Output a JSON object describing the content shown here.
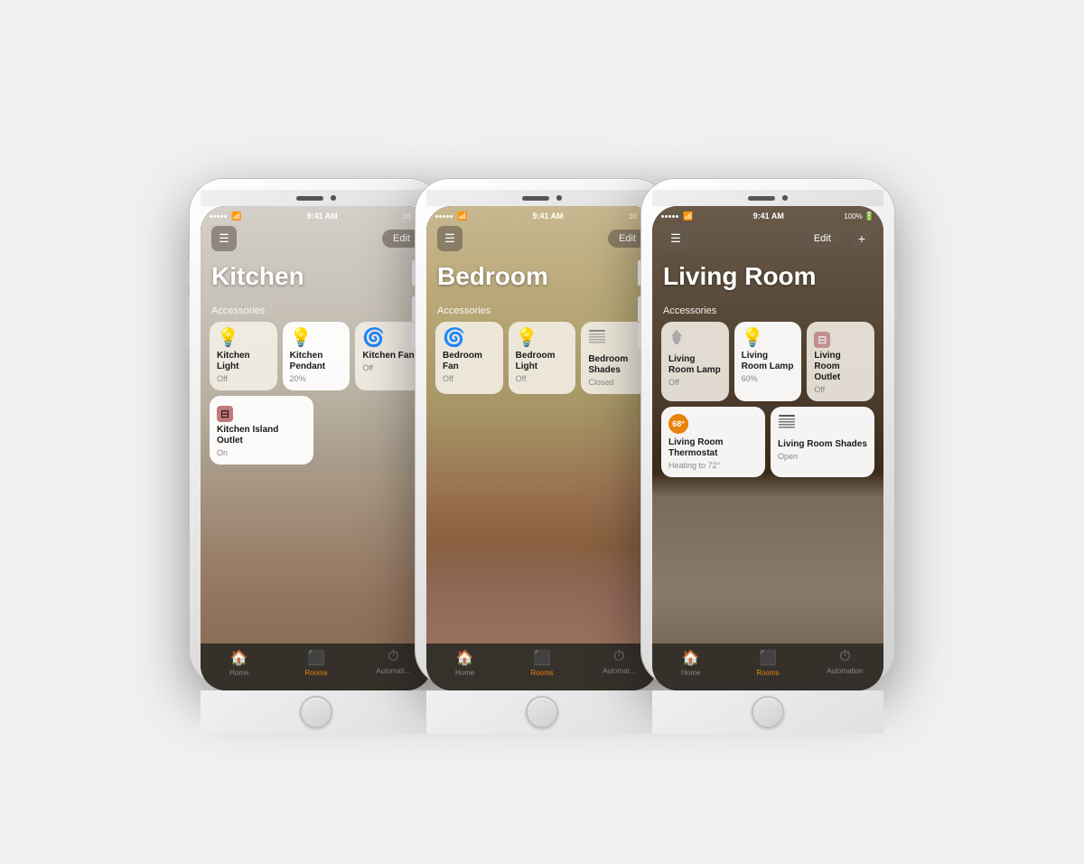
{
  "phones": [
    {
      "id": "kitchen",
      "room_name": "Kitchen",
      "bg_class": "room-bg-kitchen",
      "status_bar": {
        "left": "••••• WiFi",
        "center": "9:41 AM",
        "right": "10"
      },
      "has_plus": false,
      "accessories_label": "Accessories",
      "tiles_row1": [
        {
          "icon": "💡",
          "icon_class": "icon-gray",
          "name": "Kitchen Light",
          "status": "Off",
          "active": false
        },
        {
          "icon": "💡",
          "icon_class": "icon-blue",
          "name": "Kitchen Pendant",
          "status": "20%",
          "active": true
        },
        {
          "icon": "💨",
          "icon_class": "icon-gray",
          "name": "Kitchen Fan",
          "status": "Off",
          "active": false
        }
      ],
      "tiles_row2": [
        {
          "icon": "🔌",
          "icon_class": "icon-teal",
          "name": "Kitchen Island Outlet",
          "status": "On",
          "active": true
        }
      ]
    },
    {
      "id": "bedroom",
      "room_name": "Bedroom",
      "bg_class": "room-bg-bedroom",
      "status_bar": {
        "left": "••••• WiFi",
        "center": "9:41 AM",
        "right": "10"
      },
      "has_plus": false,
      "accessories_label": "Accessories",
      "tiles_row1": [
        {
          "icon": "💨",
          "icon_class": "icon-gray",
          "name": "Bedroom Fan",
          "status": "Off",
          "active": false
        },
        {
          "icon": "💡",
          "icon_class": "icon-gray",
          "name": "Bedroom Light",
          "status": "Off",
          "active": false
        },
        {
          "icon": "▤",
          "icon_class": "icon-gray",
          "name": "Bedroom Shades",
          "status": "Closed",
          "active": false
        }
      ],
      "tiles_row2": []
    },
    {
      "id": "livingroom",
      "room_name": "Living Room",
      "bg_class": "room-bg-livingroom",
      "status_bar": {
        "left": "••••• WiFi",
        "center": "9:41 AM",
        "right": "100%"
      },
      "has_plus": true,
      "accessories_label": "Accessories",
      "tiles_row1": [
        {
          "icon": "🪔",
          "icon_class": "icon-gray",
          "name": "Living Room Lamp",
          "status": "Off",
          "active": false
        },
        {
          "icon": "💡",
          "icon_class": "icon-yellow",
          "name": "Living Room Lamp",
          "status": "60%",
          "active": true
        },
        {
          "icon": "🔌",
          "icon_class": "icon-gray",
          "name": "Living Room Outlet",
          "status": "Off",
          "active": false
        }
      ],
      "tiles_row2": [
        {
          "icon": "thermo",
          "icon_class": "icon-orange",
          "name": "Living Room Thermostat",
          "status": "Heating to 72°",
          "active": true
        },
        {
          "icon": "shades",
          "icon_class": "icon-gray",
          "name": "Living Room Shades",
          "status": "Open",
          "active": true
        }
      ]
    }
  ],
  "tab_bar": {
    "home_label": "Home",
    "rooms_label": "Rooms",
    "automation_label": "Automation",
    "active_tab": "Rooms"
  },
  "edit_label": "Edit",
  "plus_label": "+"
}
